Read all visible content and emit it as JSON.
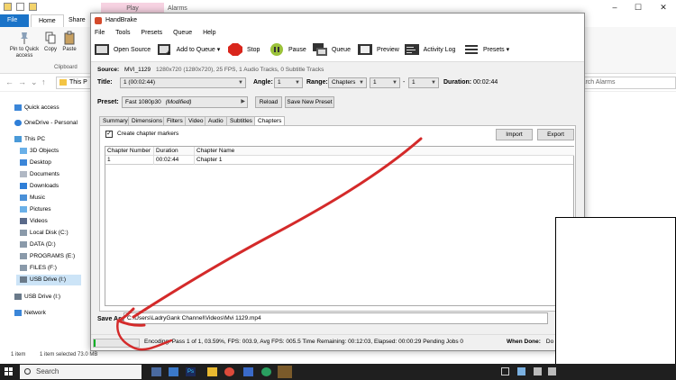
{
  "explorer": {
    "tabs": [
      "File",
      "Home",
      "Share"
    ],
    "play_bar": "Play",
    "alarms_title": "Alarms",
    "ribbon_buttons": [
      "Pin to Quick access",
      "Copy",
      "Paste"
    ],
    "clipboard_group": "Clipboard",
    "address_text": "This P",
    "search_placeholder": "Search Alarms",
    "nav_items": [
      "Quick access",
      "OneDrive - Personal",
      "This PC",
      "3D Objects",
      "Desktop",
      "Documents",
      "Downloads",
      "Music",
      "Pictures",
      "Videos",
      "Local Disk (C:)",
      "DATA (D:)",
      "PROGRAMS (E:)",
      "FILES (F:)",
      "USB Drive (I:)",
      "USB Drive (I:)",
      "Network"
    ],
    "status_items": "1 item",
    "status_selected": "1 item selected  73.0 MB"
  },
  "handbrake": {
    "title": "HandBrake",
    "menu": [
      "File",
      "Tools",
      "Presets",
      "Queue",
      "Help"
    ],
    "toolbar": {
      "open_source": "Open Source",
      "add_to_queue": "Add to Queue",
      "stop": "Stop",
      "pause": "Pause",
      "queue": "Queue",
      "preview": "Preview",
      "activity_log": "Activity Log",
      "presets": "Presets"
    },
    "source_label": "Source:",
    "source_name": "MVI_1129",
    "source_info": "1280x720 (1280x720), 25 FPS, 1 Audio Tracks, 0 Subtitle Tracks",
    "title_label": "Title:",
    "title_value": "1 (00:02:44)",
    "angle_label": "Angle:",
    "angle_value": "1",
    "range_label": "Range:",
    "range_type": "Chapters",
    "range_start": "1",
    "range_sep": "-",
    "range_end": "1",
    "duration_label": "Duration:",
    "duration_value": "00:02:44",
    "preset_label": "Preset:",
    "preset_value": "Fast 1080p30",
    "preset_modified": "(Modified)",
    "reload_button": "Reload",
    "save_preset_button": "Save New Preset",
    "tabs": [
      "Summary",
      "Dimensions",
      "Filters",
      "Video",
      "Audio",
      "Subtitles",
      "Chapters"
    ],
    "create_markers": "Create chapter markers",
    "import_button": "Import",
    "export_button": "Export",
    "chapter_headers": [
      "Chapter Number",
      "Duration",
      "Chapter Name"
    ],
    "chapter_rows": [
      {
        "number": "1",
        "duration": "00:02:44",
        "name": "Chapter 1"
      }
    ],
    "save_as_label": "Save As:",
    "save_as_value": "C:\\Users\\LadryGank Channel\\Videos\\Mvi 1129.mp4",
    "progress": 0.0359,
    "status_text": "Encoding: Pass 1 of 1,  03.59%, FPS: 003.9,  Avg FPS: 005.5 Time Remaining: 00:12:03,  Elapsed: 00:00:29   Pending Jobs 0",
    "when_done_label": "When Done:",
    "when_done_value": "Do n"
  },
  "taskbar": {
    "search_placeholder": "Search"
  },
  "colors": {
    "file_tab": "#1a73c8",
    "annotation_arrow": "#d42a2a",
    "progress_fill": "#06b025",
    "taskbar": "#1f1f1f"
  }
}
